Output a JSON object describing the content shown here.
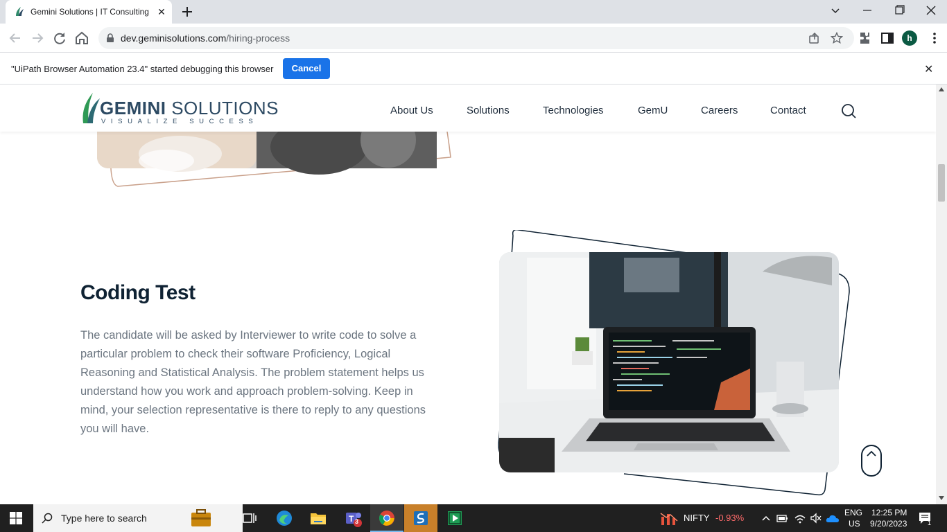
{
  "browser": {
    "tab_title": "Gemini Solutions | IT Consulting",
    "url_domain": "dev.geminisolutions.com",
    "url_path": "/hiring-process",
    "avatar_letter": "h"
  },
  "infobar": {
    "message": "\"UiPath Browser Automation 23.4\" started debugging this browser",
    "cancel_label": "Cancel"
  },
  "site": {
    "logo_main": "GEMINI",
    "logo_secondary": "SOLUTIONS",
    "logo_tagline": "VISUALIZE SUCCESS",
    "nav": [
      "About Us",
      "Solutions",
      "Technologies",
      "GemU",
      "Careers",
      "Contact"
    ]
  },
  "content": {
    "heading": "Coding Test",
    "paragraph": "The candidate will be asked by Interviewer to write code to solve a particular problem to check their software Proficiency, Logical Reasoning and Statistical Analysis. The problem statement helps us understand how you work and approach problem-solving. Keep in mind, your selection representative is there to reply to any questions you will have."
  },
  "taskbar": {
    "search_placeholder": "Type here to search",
    "ticker_name": "NIFTY",
    "ticker_change": "-0.93%",
    "ticker_color": "#ff6b6b",
    "teams_badge": "3",
    "lang_line1": "ENG",
    "lang_line2": "US",
    "time": "12:25 PM",
    "date": "9/20/2023",
    "notif_count": "1"
  },
  "colors": {
    "accent_blue": "#1a73e8",
    "brand_navy": "#2d4a63",
    "heading_dark": "#0f2233",
    "logo_green": "#3a8f4a"
  }
}
